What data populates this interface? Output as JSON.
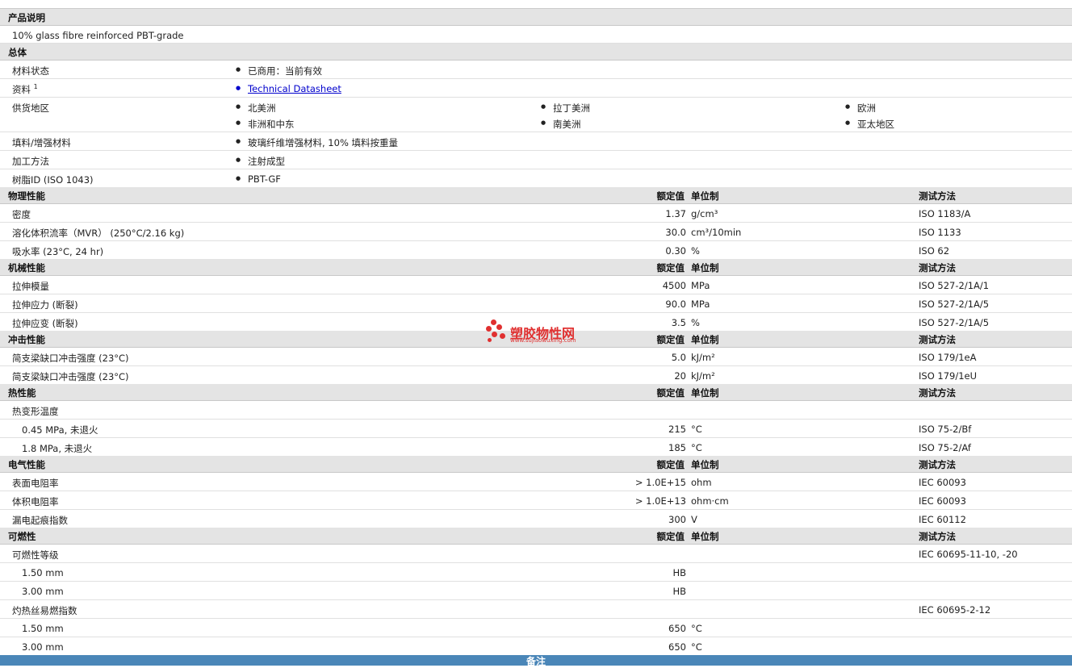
{
  "product_section": {
    "title": "产品说明",
    "description": "10% glass fibre reinforced PBT-grade"
  },
  "general": {
    "title": "总体",
    "material_status_label": "材料状态",
    "material_status_value": "已商用：当前有效",
    "docs_label": "资料",
    "docs_sup": "1",
    "docs_link": "Technical Datasheet",
    "supply_label": "供货地区",
    "supply_regions": [
      "北美洲",
      "拉丁美洲",
      "欧洲",
      "非洲和中东",
      "南美洲",
      "亚太地区"
    ],
    "filler_label": "填料/增强材料",
    "filler_value": "玻璃纤维增强材料, 10% 填料按重量",
    "process_label": "加工方法",
    "process_value": "注射成型",
    "resin_label": "树脂ID (ISO 1043)",
    "resin_value": "PBT-GF"
  },
  "columns": {
    "rated": "额定值",
    "unit": "单位制",
    "test": "测试方法"
  },
  "physical": {
    "title": "物理性能",
    "rows": [
      {
        "label": "密度",
        "value": "1.37",
        "unit": "g/cm³",
        "test": "ISO 1183/A"
      },
      {
        "label": "溶化体积流率（MVR） (250°C/2.16 kg)",
        "value": "30.0",
        "unit": "cm³/10min",
        "test": "ISO 1133"
      },
      {
        "label": "吸水率 (23°C, 24 hr)",
        "value": "0.30",
        "unit": "%",
        "test": "ISO 62"
      }
    ]
  },
  "mechanical": {
    "title": "机械性能",
    "rows": [
      {
        "label": "拉伸模量",
        "value": "4500",
        "unit": "MPa",
        "test": "ISO 527-2/1A/1"
      },
      {
        "label": "拉伸应力 (断裂)",
        "value": "90.0",
        "unit": "MPa",
        "test": "ISO 527-2/1A/5"
      },
      {
        "label": "拉伸应变 (断裂)",
        "value": "3.5",
        "unit": "%",
        "test": "ISO 527-2/1A/5"
      }
    ]
  },
  "impact": {
    "title": "冲击性能",
    "rows": [
      {
        "label": "简支梁缺口冲击强度 (23°C)",
        "value": "5.0",
        "unit": "kJ/m²",
        "test": "ISO 179/1eA"
      },
      {
        "label": "简支梁缺口冲击强度 (23°C)",
        "value": "20",
        "unit": "kJ/m²",
        "test": "ISO 179/1eU"
      }
    ]
  },
  "thermal": {
    "title": "热性能",
    "group": "热变形温度",
    "rows": [
      {
        "label": "0.45 MPa, 未退火",
        "value": "215",
        "unit": "°C",
        "test": "ISO 75-2/Bf"
      },
      {
        "label": "1.8 MPa, 未退火",
        "value": "185",
        "unit": "°C",
        "test": "ISO 75-2/Af"
      }
    ]
  },
  "electrical": {
    "title": "电气性能",
    "rows": [
      {
        "label": "表面电阻率",
        "value": "> 1.0E+15",
        "unit": "ohm",
        "test": "IEC 60093"
      },
      {
        "label": "体积电阻率",
        "value": "> 1.0E+13",
        "unit": "ohm·cm",
        "test": "IEC 60093"
      },
      {
        "label": "漏电起痕指数",
        "value": "300",
        "unit": "V",
        "test": "IEC 60112"
      }
    ]
  },
  "flammability": {
    "title": "可燃性",
    "group1": "可燃性等级",
    "group1_test": "IEC 60695-11-10, -20",
    "group1_rows": [
      {
        "label": "1.50 mm",
        "value": "HB"
      },
      {
        "label": "3.00 mm",
        "value": "HB"
      }
    ],
    "group2": "灼热丝易燃指数",
    "group2_test": "IEC 60695-2-12",
    "group2_rows": [
      {
        "label": "1.50 mm",
        "value": "650",
        "unit": "°C"
      },
      {
        "label": "3.00 mm",
        "value": "650",
        "unit": "°C"
      }
    ]
  },
  "footer": {
    "label": "备注"
  },
  "watermark": {
    "cn": "塑胶物性网",
    "en": "www.sujiaowuxing.com",
    "color": "#e03030"
  }
}
